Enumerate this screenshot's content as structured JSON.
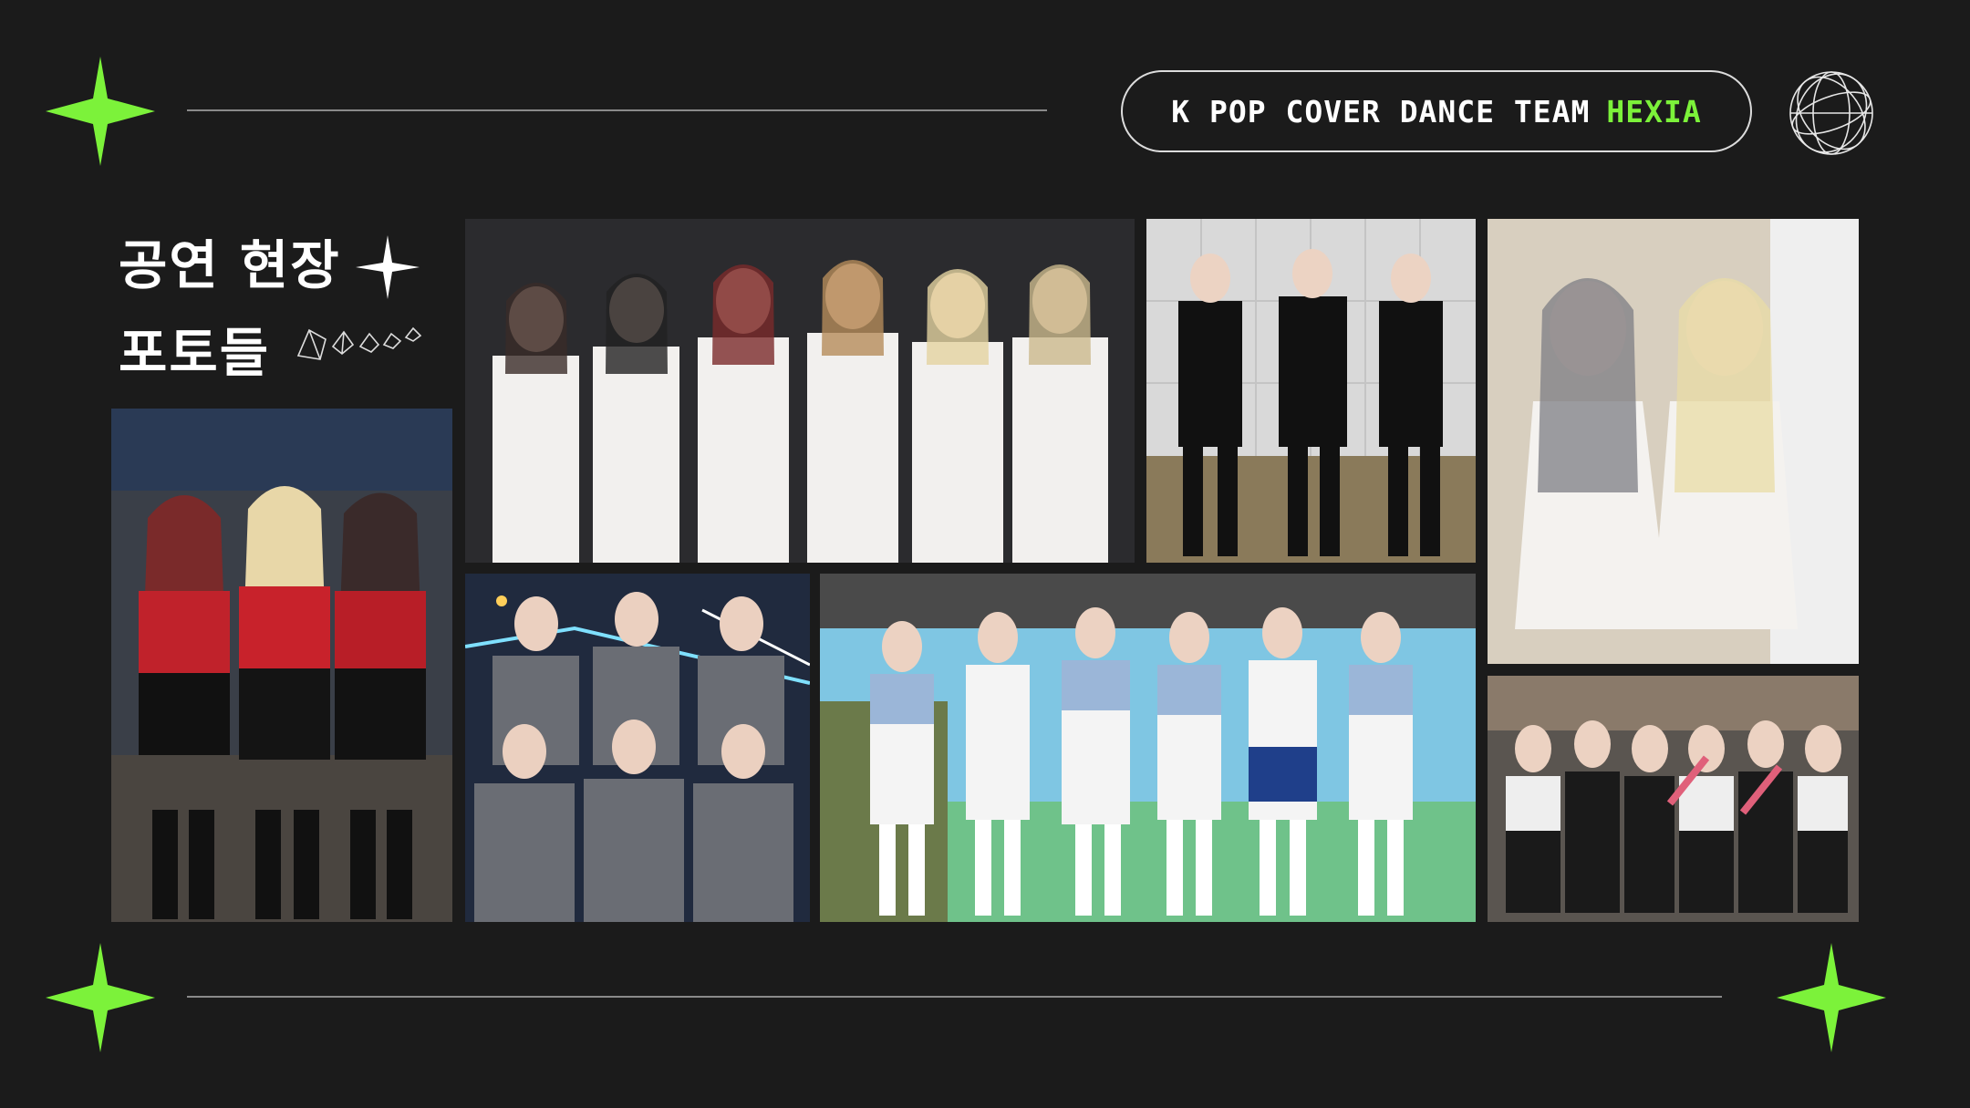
{
  "header": {
    "pill_prefix": "K POP COVER DANCE TEAM",
    "pill_accent": "HEXIA"
  },
  "section": {
    "title_line1": "공연 현장",
    "title_line2": "포토들"
  },
  "colors": {
    "background": "#1b1b1b",
    "accent": "#7cf23a",
    "text": "#ffffff",
    "rule": "#8a8a8a"
  },
  "icons": {
    "corner_star": "four-point-sparkle",
    "top_right": "wireframe-globe",
    "title_star": "sparkle",
    "title_deco": "gem-outlines"
  },
  "photos": [
    {
      "name": "photo-red-black-trio"
    },
    {
      "name": "photo-white-outfit-group"
    },
    {
      "name": "photo-black-outfit-salute"
    },
    {
      "name": "photo-white-dress-duo"
    },
    {
      "name": "photo-school-uniform-night"
    },
    {
      "name": "photo-outdoor-stage-group"
    },
    {
      "name": "photo-street-group-flowers"
    }
  ]
}
